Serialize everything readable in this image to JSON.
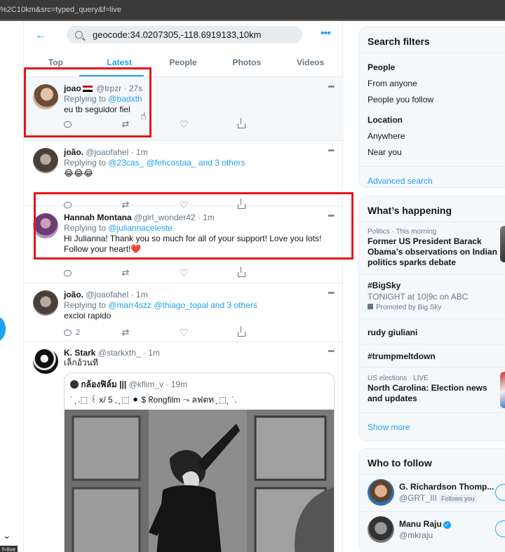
{
  "browser": {
    "url_fragment": "%2C10km&src=typed_query&f=live"
  },
  "left": {
    "chevron": "⌄",
    "tooltip": "f=live"
  },
  "search": {
    "query": "geocode:34.0207305,-118.6919133,10km",
    "back_icon": "arrow-left-icon",
    "more": "•••"
  },
  "tabs": [
    {
      "label": "Top"
    },
    {
      "label": "Latest",
      "active": true
    },
    {
      "label": "People"
    },
    {
      "label": "Photos"
    },
    {
      "label": "Videos"
    }
  ],
  "tweets": [
    {
      "name": "joao",
      "handle": "@trpzr",
      "time": "· 27s",
      "replying_prefix": "Replying to ",
      "replying_to": "@badxth",
      "text": "eu tb seguidor fiel",
      "actions": {
        "reply": "",
        "retweet": "",
        "like": ""
      }
    },
    {
      "name": "joão.",
      "handle": "@joaofahel",
      "time": "· 1m",
      "replying_prefix": "Replying to ",
      "replying_to": "@23cas_ @fehcostaa_ and 3 others",
      "text": "😂😂😂",
      "actions": {
        "reply": "",
        "retweet": "",
        "like": ""
      }
    },
    {
      "name": "Hannah Montana",
      "handle": "@girl_wonder42",
      "time": "· 1m",
      "replying_prefix": "Replying to ",
      "replying_to": "@juliannaceleste",
      "text": "Hi Julianna! Thank you so much for all of your support! Love you lots! Follow your heart!❤️",
      "actions": {
        "reply": "",
        "retweet": "",
        "like": ""
      }
    },
    {
      "name": "joão.",
      "handle": "@joaofahel",
      "time": "· 1m",
      "replying_prefix": "Replying to ",
      "replying_to": "@marr4szz @thiago_topal and 3 others",
      "text": "excloi rapido",
      "actions": {
        "reply": "2",
        "retweet": "",
        "like": ""
      }
    },
    {
      "name": "K. Stark",
      "handle": "@starkxth_",
      "time": "· 1m",
      "text": "เล็กอ้วนที",
      "quote": {
        "name": "กล้องฟิล์ม |||",
        "handle": "@kflim_v",
        "time": "· 19m",
        "text": "˙ ̟ .⬚ ꒰ x/ 5 ‚ ̟ ⬚ ⚫ $ ᖇongfilm ⤳ ลฟตท ̟ ⬚˛ ˙."
      }
    }
  ],
  "filters": {
    "title": "Search filters",
    "people_heading": "People",
    "people_options": [
      "From anyone",
      "People you follow"
    ],
    "location_heading": "Location",
    "location_options": [
      "Anywhere",
      "Near you"
    ],
    "advanced": "Advanced search"
  },
  "happening": {
    "title": "What’s happening",
    "trends": [
      {
        "sub": "Politics · This morning",
        "title": "Former US President Barack Obama’s observations on Indian politics sparks debate"
      },
      {
        "title": "#BigSky",
        "sub": "TONIGHT at 10|9c on ABC",
        "promo": "Promoted by Big Sky"
      },
      {
        "title": "rudy giuliani"
      },
      {
        "title": "#trumpmeltdown"
      },
      {
        "sub": "US elections · LIVE",
        "title": "North Carolina: Election news and updates"
      }
    ],
    "show_more": "Show more"
  },
  "who_to_follow": {
    "title": "Who to follow",
    "accounts": [
      {
        "name": "G. Richardson Thomp...",
        "handle": "@GRT_III",
        "badge": "Follows you"
      },
      {
        "name": "Manu Raju",
        "handle": "@mkraju",
        "verified": true
      }
    ]
  },
  "colors": {
    "accent": "#1da1f2",
    "highlight": "#e5161a",
    "muted": "#657786"
  }
}
